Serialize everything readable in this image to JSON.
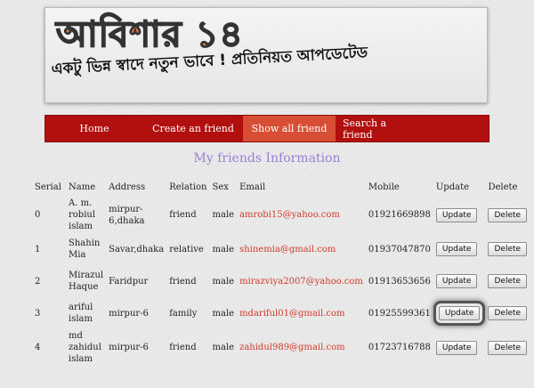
{
  "banner": {
    "title": "আবিশার ১৪",
    "subtitle": "একটু ভিন্ন স্বাদে নতুন ভাবে ! প্রতিনিয়ত আপডেটেড"
  },
  "nav": {
    "items": [
      "Home",
      "Create an friend",
      "Show all friend",
      "Search a friend"
    ],
    "active": "Show all friend"
  },
  "section_title": "My friends Information",
  "table": {
    "headers": [
      "Serial",
      "Name",
      "Address",
      "Relation",
      "Sex",
      "Email",
      "Mobile",
      "Update",
      "Delete"
    ],
    "rows": [
      {
        "serial": "0",
        "name": "A. m. robiul islam",
        "address": "mirpur-6,dhaka",
        "relation": "friend",
        "sex": "male",
        "email": "amrobi15@yahoo.com",
        "mobile": "01921669898",
        "update": "Update",
        "delete": "Delete"
      },
      {
        "serial": "1",
        "name": "Shahin Mia",
        "address": "Savar,dhaka",
        "relation": "relative",
        "sex": "male",
        "email": "shinemia@gmail.com",
        "mobile": "01937047870",
        "update": "Update",
        "delete": "Delete"
      },
      {
        "serial": "2",
        "name": "Mirazul Haque",
        "address": "Faridpur",
        "relation": "friend",
        "sex": "male",
        "email": "mirazviya2007@yahoo.com",
        "mobile": "01913653656",
        "update": "Update",
        "delete": "Delete"
      },
      {
        "serial": "3",
        "name": "ariful islam",
        "address": "mirpur-6",
        "relation": "family",
        "sex": "male",
        "email": "mdariful01@gmail.com",
        "mobile": "01925599361",
        "update": "Update",
        "delete": "Delete"
      },
      {
        "serial": "4",
        "name": "md zahidul islam",
        "address": "mirpur-6",
        "relation": "friend",
        "sex": "male",
        "email": "zahidul989@gmail.com",
        "mobile": "01723716788",
        "update": "Update",
        "delete": "Delete"
      }
    ],
    "highlighted_row": 3
  },
  "colors": {
    "nav_bg": "#b20f0f",
    "nav_active": "#d74e34",
    "title": "#9a7fd6",
    "email": "#d03a2a"
  }
}
